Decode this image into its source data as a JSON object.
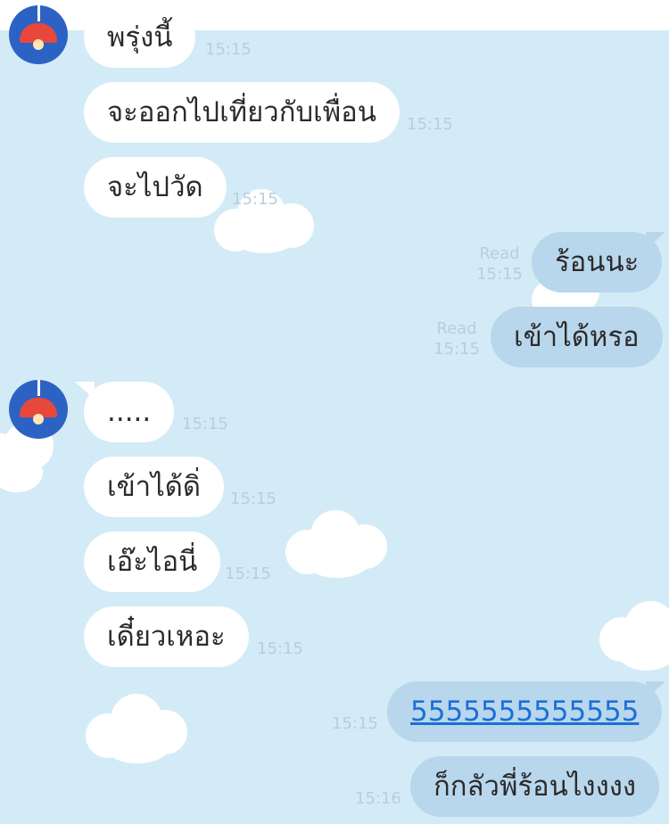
{
  "colors": {
    "chat_background": "#d3ebf6",
    "incoming_bubble": "#ffffff",
    "outgoing_bubble": "#b8d7ec",
    "link": "#1d6fd6",
    "avatar_background": "#2d62c5",
    "lamp": "#e8483b"
  },
  "avatar_icon": "red-lamp-icon",
  "messages": [
    {
      "direction": "in",
      "text": "พรุ่งนี้",
      "time": "15:15"
    },
    {
      "direction": "in",
      "text": "จะออกไปเที่ยวกับเพื่อน",
      "time": "15:15"
    },
    {
      "direction": "in",
      "text": "จะไปวัด",
      "time": "15:15"
    },
    {
      "direction": "out",
      "text": "ร้อนนะ",
      "read": "Read",
      "time": "15:15"
    },
    {
      "direction": "out",
      "text": "เข้าได้หรอ",
      "read": "Read",
      "time": "15:15"
    },
    {
      "direction": "in",
      "text": ".....",
      "time": "15:15"
    },
    {
      "direction": "in",
      "text": "เข้าได้ดิ่",
      "time": "15:15"
    },
    {
      "direction": "in",
      "text": "เอ๊ะไอนี่",
      "time": "15:15"
    },
    {
      "direction": "in",
      "text": "เดี๋ยวเหอะ",
      "time": "15:15"
    },
    {
      "direction": "out",
      "text": "5555555555555",
      "is_link": true,
      "time": "15:15"
    },
    {
      "direction": "out",
      "text": "ก็กลัวพี่ร้อนไงงงง",
      "time": "15:16"
    }
  ]
}
